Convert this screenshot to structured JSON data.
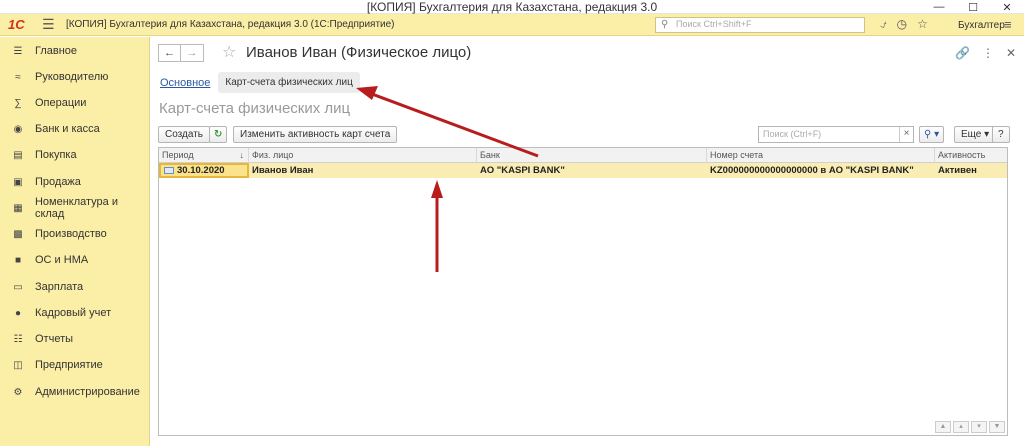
{
  "window": {
    "title": "[КОПИЯ] Бухгалтерия для Казахстана, редакция 3.0",
    "controls": [
      "minimize-icon",
      "maximize-icon",
      "close-icon"
    ]
  },
  "appbar": {
    "logo": "1С",
    "title": "[КОПИЯ] Бухгалтерия для Казахстана, редакция 3.0  (1С:Предприятие)",
    "search_placeholder": "Поиск Ctrl+Shift+F",
    "user": "Бухгалтер"
  },
  "sidebar": {
    "items": [
      {
        "label": "Главное",
        "icon": "menu-icon"
      },
      {
        "label": "Руководителю",
        "icon": "chart-line-icon"
      },
      {
        "label": "Операции",
        "icon": "operations-icon"
      },
      {
        "label": "Банк и касса",
        "icon": "money-icon"
      },
      {
        "label": "Покупка",
        "icon": "cart-icon"
      },
      {
        "label": "Продажа",
        "icon": "bag-icon"
      },
      {
        "label": "Номенклатура и склад",
        "icon": "grid-icon"
      },
      {
        "label": "Производство",
        "icon": "factory-icon"
      },
      {
        "label": "ОС и НМА",
        "icon": "truck-icon"
      },
      {
        "label": "Зарплата",
        "icon": "wallet-icon"
      },
      {
        "label": "Кадровый учет",
        "icon": "people-icon"
      },
      {
        "label": "Отчеты",
        "icon": "report-icon"
      },
      {
        "label": "Предприятие",
        "icon": "building-icon"
      },
      {
        "label": "Администрирование",
        "icon": "gear-icon"
      }
    ]
  },
  "page": {
    "title": "Иванов Иван (Физическое лицо)",
    "tabs": [
      {
        "label": "Основное",
        "active": false
      },
      {
        "label": "Карт-счета физических лиц",
        "active": true
      }
    ],
    "section_title": "Карт-счета физических лиц"
  },
  "toolbar": {
    "create_label": "Создать",
    "change_activity_label": "Изменить активность карт счета",
    "search_placeholder": "Поиск (Ctrl+F)",
    "more_label": "Еще",
    "help_label": "?"
  },
  "table": {
    "columns": [
      "Период",
      "Физ. лицо",
      "Банк",
      "Номер счета",
      "Активность счета"
    ],
    "rows": [
      {
        "period": "30.10.2020",
        "person": "Иванов Иван",
        "bank": "АО \"KASPI BANK\"",
        "account": "KZ000000000000000000 в АО \"KASPI BANK\"",
        "status": "Активен"
      }
    ]
  },
  "colors": {
    "sidebar_bg": "#fbeea6",
    "selected_row": "#f9edb4",
    "annotation_arrow": "#b81c1c",
    "link": "#2b58a6"
  }
}
